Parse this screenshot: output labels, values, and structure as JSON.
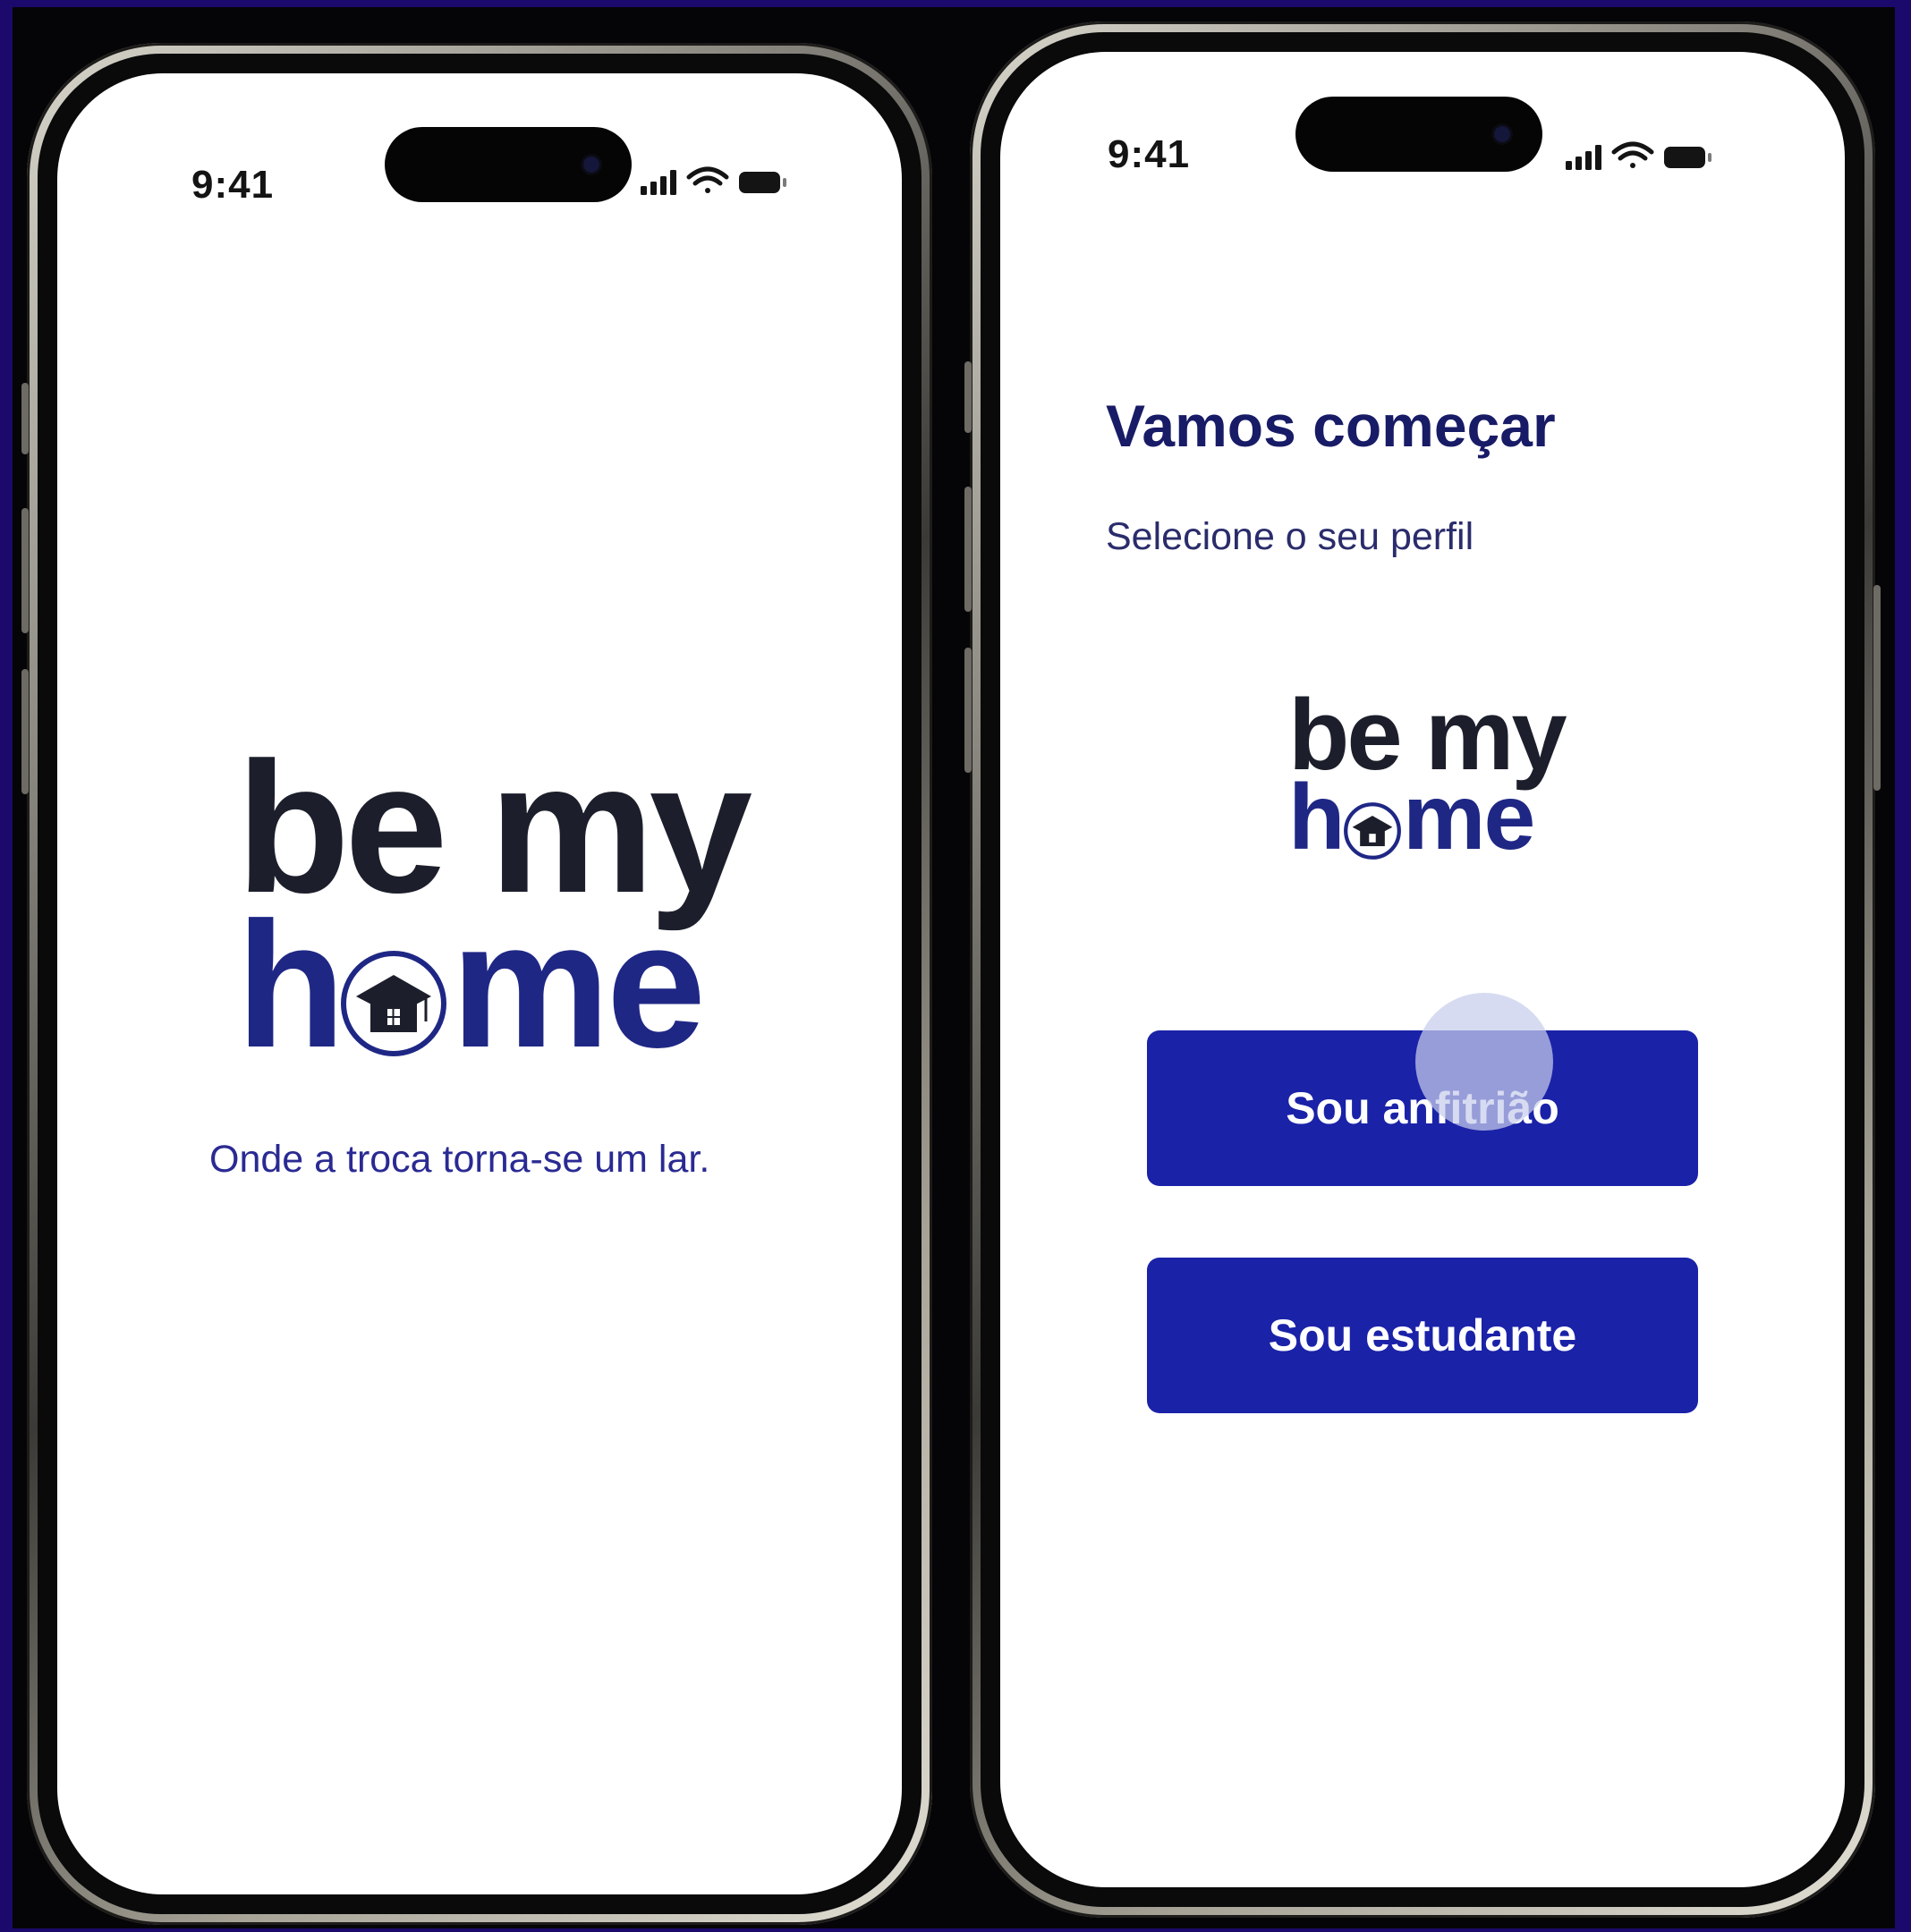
{
  "colors": {
    "frame": "#1b0a6b",
    "navy": "#1f2785",
    "logo_dark": "#1c1f2b",
    "button": "#1a22a8"
  },
  "status_bar": {
    "time": "9:41",
    "icons": [
      "signal-icon",
      "wifi-icon",
      "battery-icon"
    ]
  },
  "splash": {
    "logo": {
      "line1": "be my",
      "line2_h": "h",
      "line2_me": "me"
    },
    "tagline": "Onde a troca torna-se um lar."
  },
  "profile": {
    "title": "Vamos começar",
    "subtitle": "Selecione o seu perfil",
    "logo": {
      "line1": "be my",
      "line2_h": "h",
      "line2_me": "me"
    },
    "buttons": [
      {
        "label": "Sou anfitrião"
      },
      {
        "label": "Sou estudante"
      }
    ]
  }
}
